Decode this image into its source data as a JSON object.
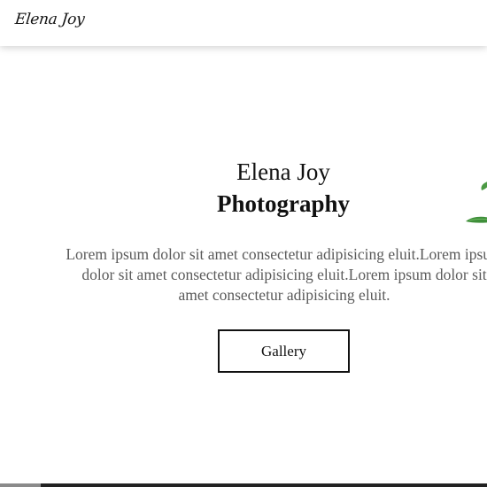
{
  "navbar": {
    "logo_text": "Elena Joy"
  },
  "hero": {
    "title_line1": "Elena Joy",
    "title_line2": "Photography",
    "description": "Lorem ipsum dolor sit amet consectetur adipisicing eluit.Lorem ipsum dolor sit amet consectetur adipisicing eluit.Lorem ipsum dolor sit amet consectetur adipisicing eluit.",
    "button_label": "Gallery",
    "decoration_icon": "leaf-icon"
  },
  "colors": {
    "text": "#111111",
    "muted_text": "#5a5a5a",
    "background": "#ffffff",
    "leaf": "#3f8f3a"
  }
}
